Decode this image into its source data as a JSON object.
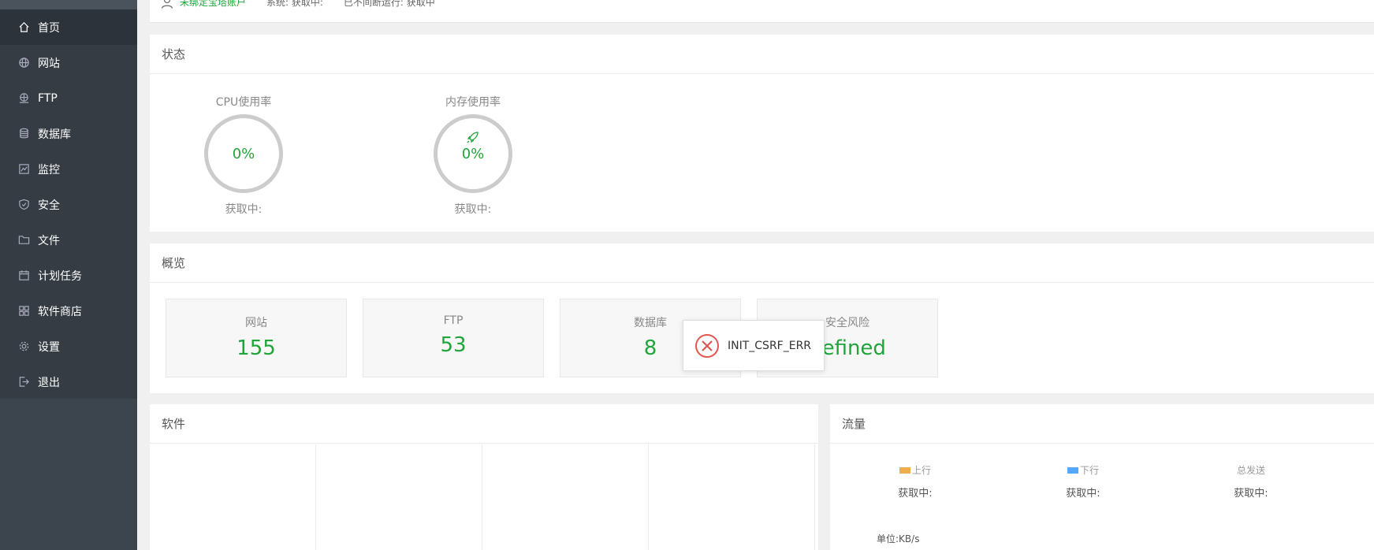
{
  "sidebar": {
    "items": [
      {
        "label": "首页",
        "icon": "home-icon",
        "active": true
      },
      {
        "label": "网站",
        "icon": "globe-icon"
      },
      {
        "label": "FTP",
        "icon": "ftp-icon"
      },
      {
        "label": "数据库",
        "icon": "database-icon"
      },
      {
        "label": "监控",
        "icon": "monitor-icon"
      },
      {
        "label": "安全",
        "icon": "shield-icon"
      },
      {
        "label": "文件",
        "icon": "folder-icon"
      },
      {
        "label": "计划任务",
        "icon": "calendar-icon"
      },
      {
        "label": "软件商店",
        "icon": "grid-icon"
      },
      {
        "label": "设置",
        "icon": "gear-icon"
      },
      {
        "label": "退出",
        "icon": "logout-icon"
      }
    ]
  },
  "topbar": {
    "account": "未绑定宝塔账户",
    "system": "系统:  获取中:",
    "uptime": "已不间断运行: 获取中"
  },
  "status": {
    "title": "状态",
    "cpu": {
      "label": "CPU使用率",
      "value": "0%",
      "sub": "获取中:"
    },
    "memory": {
      "label": "内存使用率",
      "value": "0%",
      "sub": "获取中:"
    }
  },
  "overview": {
    "title": "概览",
    "cards": [
      {
        "label": "网站",
        "value": "155"
      },
      {
        "label": "FTP",
        "value": "53"
      },
      {
        "label": "数据库",
        "value": "8"
      },
      {
        "label": "安全风险",
        "value": "defined"
      }
    ]
  },
  "toast": {
    "message": "INIT_CSRF_ERR"
  },
  "software": {
    "title": "软件"
  },
  "traffic": {
    "title": "流量",
    "up": {
      "label": "上行",
      "value": "获取中:",
      "color": "#f0ad4e"
    },
    "down": {
      "label": "下行",
      "value": "获取中:",
      "color": "#52a9ff"
    },
    "total": {
      "label": "总发送",
      "value": "获取中:"
    },
    "unit": "单位:KB/s"
  },
  "colors": {
    "accent": "#20a53a",
    "sidebar": "#353c44",
    "error": "#e4554f"
  }
}
